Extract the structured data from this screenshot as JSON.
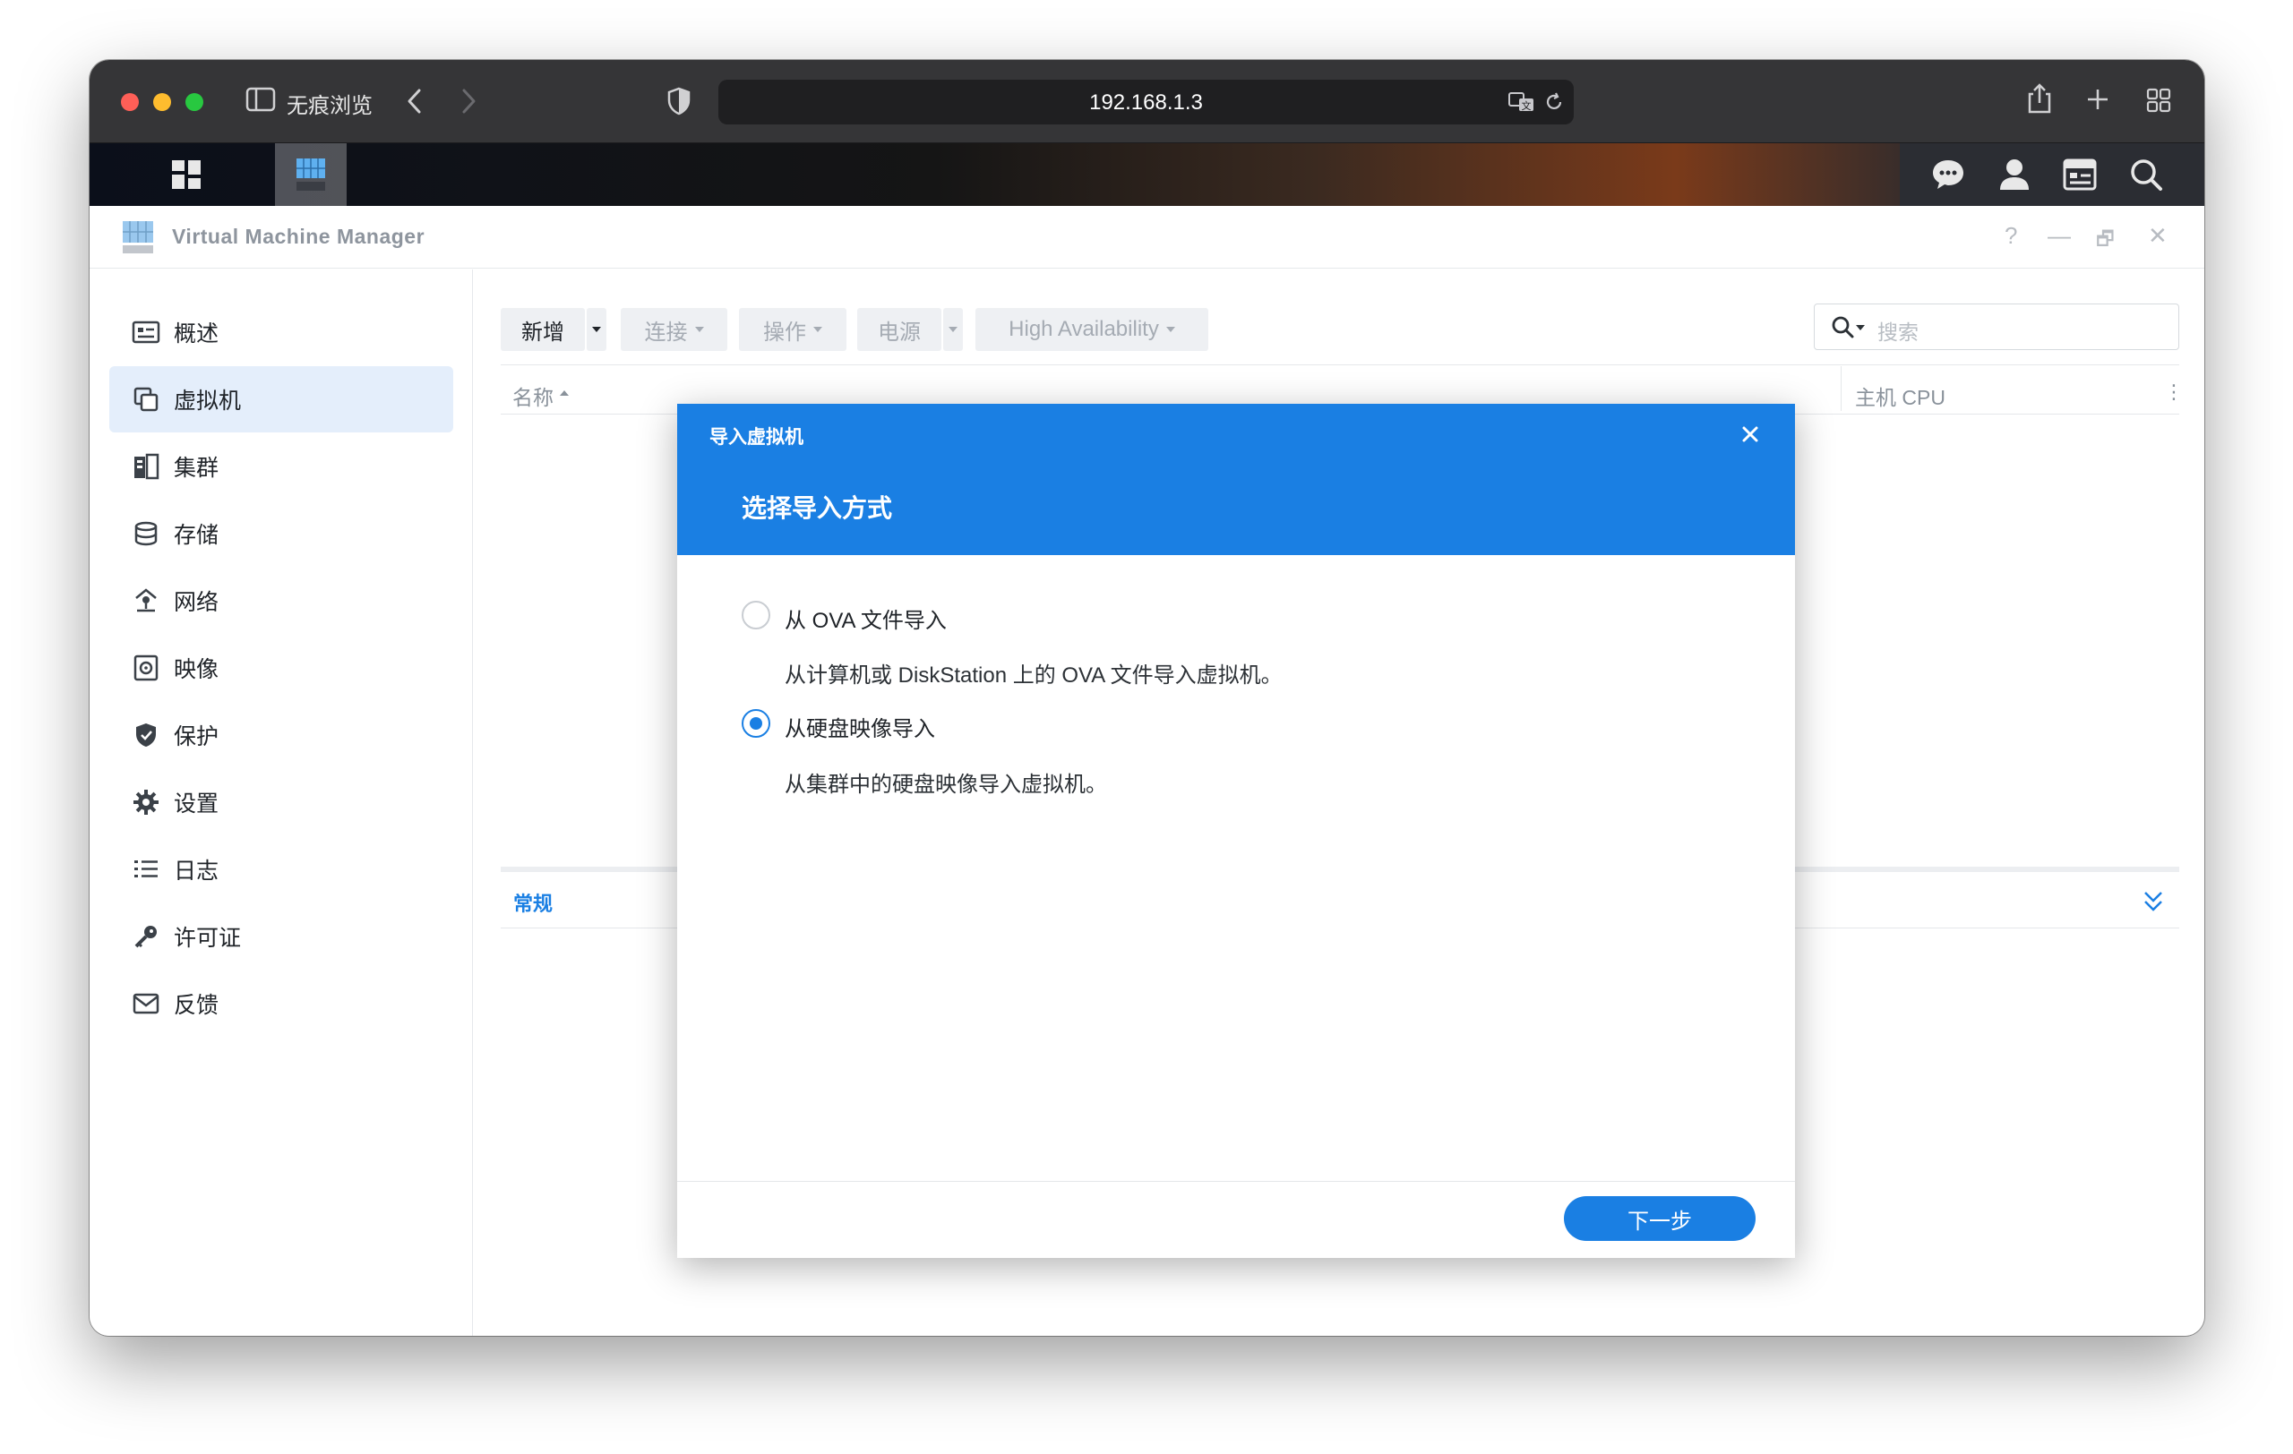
{
  "browser": {
    "mode_label": "无痕浏览",
    "url": "192.168.1.3"
  },
  "app": {
    "title": "Virtual Machine Manager",
    "window_controls": [
      "?",
      "—",
      "🗗",
      "✕"
    ]
  },
  "sidebar": {
    "items": [
      {
        "label": "概述",
        "icon": "overview-icon"
      },
      {
        "label": "虚拟机",
        "icon": "virtual-machine-icon",
        "active": true
      },
      {
        "label": "集群",
        "icon": "cluster-icon"
      },
      {
        "label": "存储",
        "icon": "storage-icon"
      },
      {
        "label": "网络",
        "icon": "network-icon"
      },
      {
        "label": "映像",
        "icon": "image-icon"
      },
      {
        "label": "保护",
        "icon": "protection-icon"
      },
      {
        "label": "设置",
        "icon": "settings-gear-icon"
      },
      {
        "label": "日志",
        "icon": "log-list-icon"
      },
      {
        "label": "许可证",
        "icon": "license-key-icon"
      },
      {
        "label": "反馈",
        "icon": "feedback-mail-icon"
      }
    ]
  },
  "toolbar": {
    "new_label": "新增",
    "connect_label": "连接",
    "action_label": "操作",
    "power_label": "电源",
    "ha_label": "High Availability",
    "search_placeholder": "搜索"
  },
  "table": {
    "col_name": "名称",
    "col_host_cpu": "主机 CPU"
  },
  "detail": {
    "tab_general": "常规"
  },
  "modal": {
    "header_small": "导入虚拟机",
    "title": "选择导入方式",
    "options": [
      {
        "label": "从 OVA 文件导入",
        "desc": "从计算机或 DiskStation 上的 OVA 文件导入虚拟机。",
        "selected": false
      },
      {
        "label": "从硬盘映像导入",
        "desc": "从集群中的硬盘映像导入虚拟机。",
        "selected": true
      }
    ],
    "next_label": "下一步"
  },
  "colors": {
    "accent": "#1a7fe3",
    "sidebar_active": "#e4eefb"
  }
}
